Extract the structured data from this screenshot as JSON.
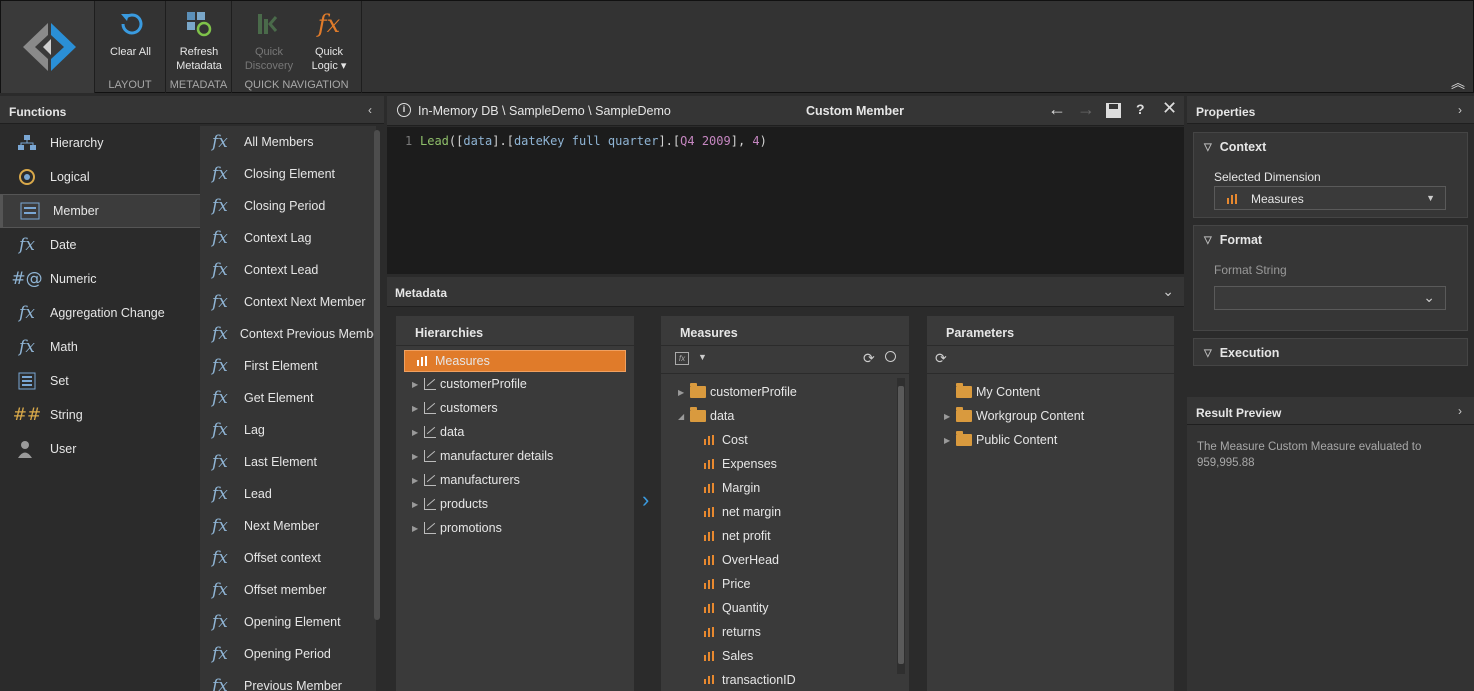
{
  "ribbon": {
    "clear_all": "Clear All",
    "layout_group": "LAYOUT",
    "refresh_metadata_l1": "Refresh",
    "refresh_metadata_l2": "Metadata",
    "metadata_group": "METADATA",
    "quick_discovery_l1": "Quick",
    "quick_discovery_l2": "Discovery",
    "quick_logic_l1": "Quick",
    "quick_logic_l2": "Logic ▾",
    "quick_nav_group": "QUICK NAVIGATION"
  },
  "functions": {
    "title": "Functions",
    "categories": [
      {
        "label": "Hierarchy",
        "icon": "hierarchy-icon"
      },
      {
        "label": "Logical",
        "icon": "logical-icon"
      },
      {
        "label": "Member",
        "icon": "member-icon"
      },
      {
        "label": "Date",
        "icon": "date-icon"
      },
      {
        "label": "Numeric",
        "icon": "numeric-icon"
      },
      {
        "label": "Aggregation Change",
        "icon": "fx-icon"
      },
      {
        "label": "Math",
        "icon": "fx-icon"
      },
      {
        "label": "Set",
        "icon": "set-icon"
      },
      {
        "label": "String",
        "icon": "string-icon"
      },
      {
        "label": "User",
        "icon": "user-icon"
      }
    ],
    "selected_category": "Member",
    "items": [
      "All Members",
      "Closing Element",
      "Closing Period",
      "Context Lag",
      "Context Lead",
      "Context Next Member",
      "Context Previous Member",
      "First Element",
      "Get Element",
      "Lag",
      "Last Element",
      "Lead",
      "Next Member",
      "Offset context",
      "Offset member",
      "Opening Element",
      "Opening Period",
      "Previous Member"
    ]
  },
  "editor": {
    "path": "In-Memory DB \\ SampleDemo \\ SampleDemo",
    "title": "Custom Member",
    "line_number": "1",
    "code_fn": "Lead",
    "code_p1": "([",
    "code_a": "data",
    "code_p2": "].[",
    "code_b": "dateKey full quarter",
    "code_p3": "].[",
    "code_c": "Q4 2009",
    "code_p4": "], ",
    "code_n": "4",
    "code_p5": ")"
  },
  "metadata": {
    "title": "Metadata",
    "hierarchies": {
      "title": "Hierarchies",
      "selected": "Measures",
      "items": [
        "customerProfile",
        "customers",
        "data",
        "manufacturer details",
        "manufacturers",
        "products",
        "promotions"
      ]
    },
    "measures": {
      "title": "Measures",
      "folders": [
        "customerProfile",
        "data"
      ],
      "items": [
        "Cost",
        "Expenses",
        "Margin",
        "net margin",
        "net profit",
        "OverHead",
        "Price",
        "Quantity",
        "returns",
        "Sales",
        "transactionID"
      ]
    },
    "parameters": {
      "title": "Parameters",
      "items": [
        "My Content",
        "Workgroup Content",
        "Public Content"
      ]
    }
  },
  "properties": {
    "title": "Properties",
    "context_title": "Context",
    "selected_dimension_label": "Selected Dimension",
    "selected_dimension_value": "Measures",
    "format_title": "Format",
    "format_string_label": "Format String",
    "format_string_value": "",
    "execution_title": "Execution"
  },
  "result_preview": {
    "title": "Result Preview",
    "text_l1": "The Measure Custom Measure evaluated to",
    "text_l2": "959,995.88"
  },
  "colors": {
    "accent_orange": "#e07b2a",
    "fx_blue": "#8fb4d4",
    "code_green": "#8fbf6a",
    "code_number": "#c586c0"
  }
}
